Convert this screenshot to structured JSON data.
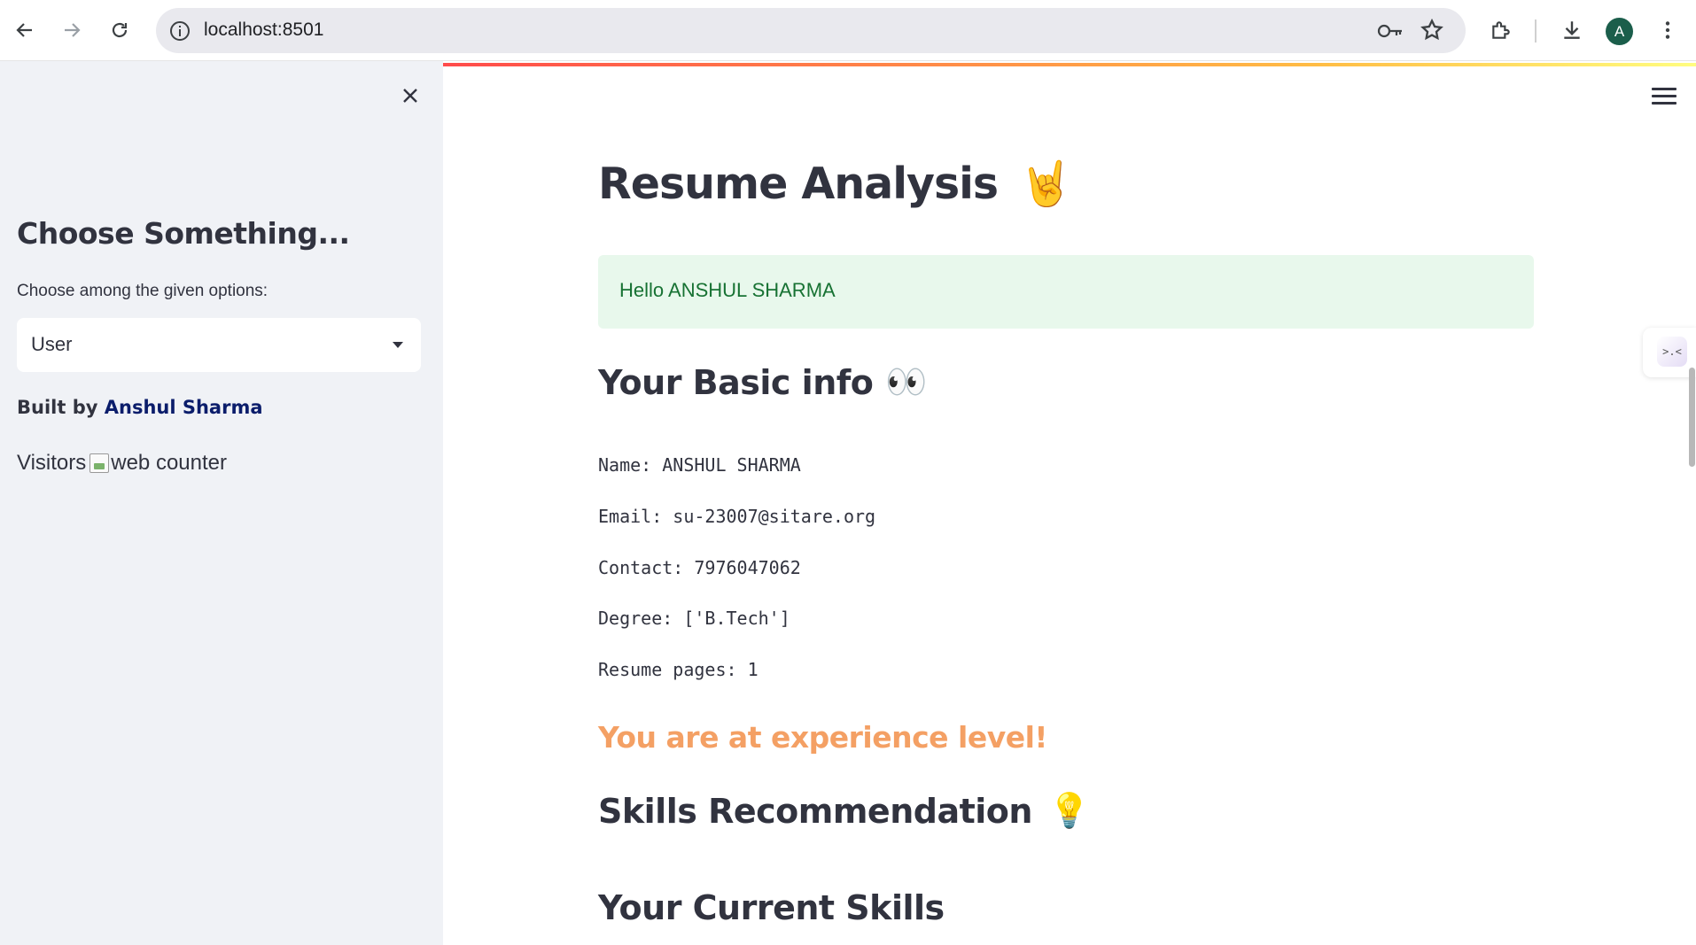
{
  "browser": {
    "url": "localhost:8501",
    "profile_initial": "A"
  },
  "sidebar": {
    "title": "Choose Something...",
    "select_label": "Choose among the given options:",
    "select_value": "User",
    "built_prefix": "Built by ",
    "built_author": "Anshul Sharma",
    "visitors_label": "Visitors",
    "counter_alt": "web counter"
  },
  "main": {
    "title": "Resume Analysis",
    "title_emoji": "🤘",
    "greeting": "Hello ANSHUL SHARMA",
    "basic_info_heading": "Your Basic info",
    "basic_info_emoji": "👀",
    "info_lines": [
      "Name: ANSHUL SHARMA",
      "Email: su-23007@sitare.org",
      "Contact: 7976047062",
      "Degree: ['B.Tech']",
      "Resume pages: 1"
    ],
    "level_text": "You are at experience level!",
    "skills_heading": "Skills Recommendation",
    "skills_emoji": "💡",
    "current_skills_heading": "Your Current Skills"
  },
  "colors": {
    "sidebar_bg": "#f0f2f6",
    "success_bg": "#e8f8ec",
    "success_text": "#177233",
    "level_text": "#f4a064",
    "link": "#0b1d6b"
  }
}
